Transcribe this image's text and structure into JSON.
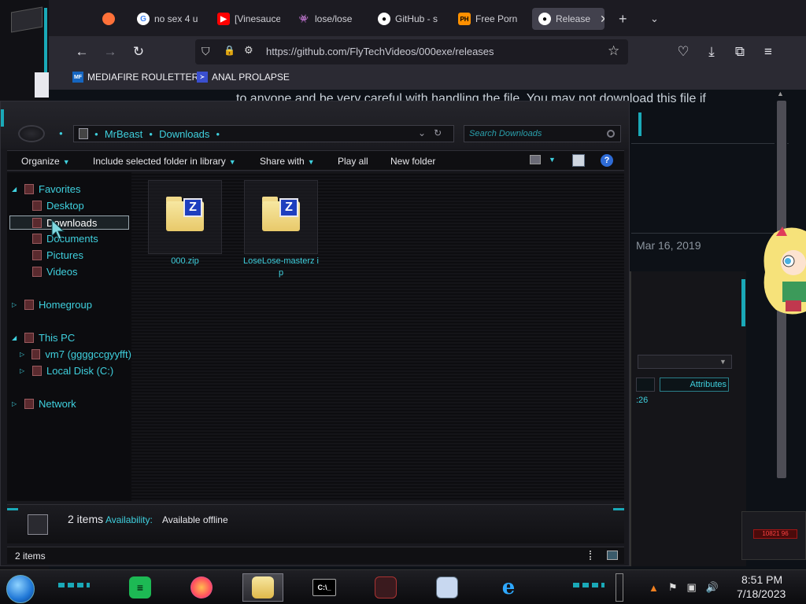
{
  "browser": {
    "tabs": [
      {
        "label": "",
        "favicon": "firefox-icon",
        "color": "#ff7139"
      },
      {
        "label": "no sex 4 u",
        "favicon": "google-icon",
        "color": "#4285f4"
      },
      {
        "label": "[Vinesauce",
        "favicon": "youtube-icon",
        "color": "#ff0000"
      },
      {
        "label": "lose/lose",
        "favicon": "invader-icon",
        "color": "#ffffff"
      },
      {
        "label": "GitHub - s",
        "favicon": "github-icon",
        "color": "#ffffff"
      },
      {
        "label": "Free Porn",
        "favicon": "ph-icon",
        "color": "#ff9000"
      },
      {
        "label": "Release",
        "favicon": "github-icon",
        "color": "#ffffff"
      }
    ],
    "url": "https://github.com/FlyTechVideos/000exe/releases",
    "bookmarks": [
      {
        "label": "MEDIAFIRE ROULETTER",
        "icon": "mediafire-icon"
      },
      {
        "label": "ANAL PROLAPSE",
        "icon": "bookmark-icon"
      }
    ],
    "page_text": "to anyone and be very careful with handling the file. You may not download this file if",
    "page_date": "Mar 16, 2019"
  },
  "explorer": {
    "breadcrumb": [
      "MrBeast",
      "Downloads"
    ],
    "search_placeholder": "Search Downloads",
    "toolbar": {
      "organize": "Organize",
      "include": "Include selected folder in library",
      "share": "Share with",
      "play": "Play all",
      "new_folder": "New folder",
      "help": "?"
    },
    "nav": {
      "favorites": "Favorites",
      "desktop": "Desktop",
      "downloads": "Downloads",
      "documents": "Documents",
      "pictures": "Pictures",
      "videos": "Videos",
      "homegroup": "Homegroup",
      "thispc": "This PC",
      "vm7": "vm7 (ggggccgyyfft)",
      "localdisk": "Local Disk (C:)",
      "network": "Network"
    },
    "files": [
      {
        "name": "000.zip"
      },
      {
        "name": "LoseLose-masterz ip"
      }
    ],
    "details": {
      "count": "2 items",
      "availability_label": "Availability:",
      "availability_value": "Available offline"
    },
    "status": "2 items"
  },
  "background_window": {
    "attributes_label": "Attributes",
    "time_fragment": ":26"
  },
  "gadget_text": "10821 96",
  "taskbar": {
    "apps": [
      "spotify-icon",
      "firefox-icon",
      "explorer-icon",
      "cmd-icon",
      "media-icon",
      "monitor-icon",
      "ie-icon"
    ],
    "clock_time": "8:51 PM",
    "clock_date": "7/18/2023"
  }
}
